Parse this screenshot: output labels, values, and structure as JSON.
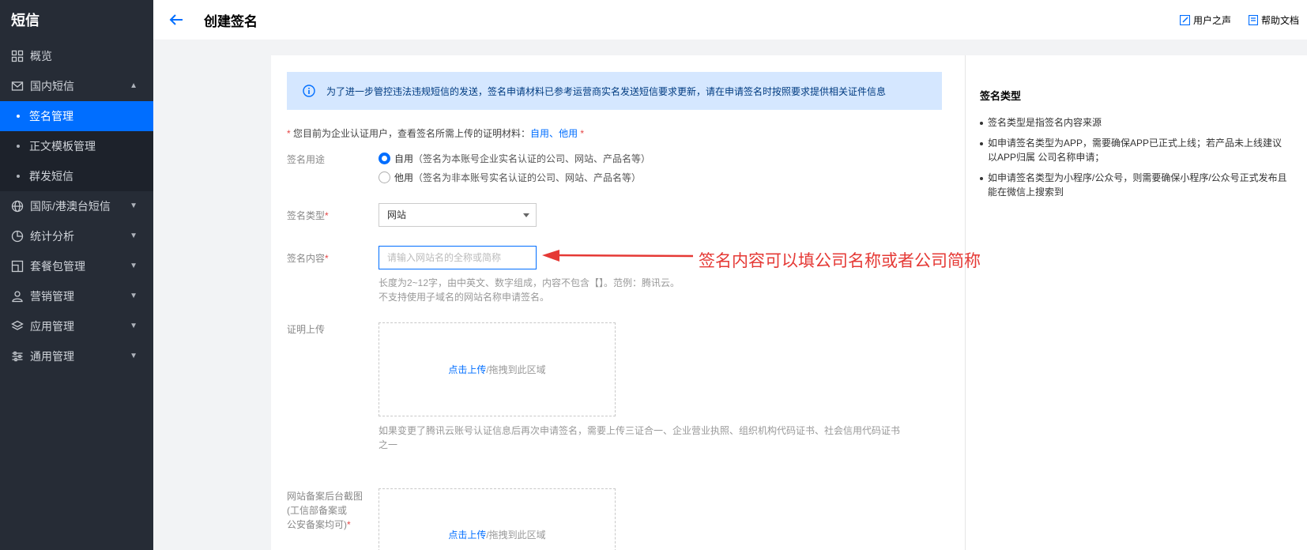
{
  "sidebar": {
    "brand": "短信",
    "items": [
      {
        "label": "概览",
        "icon": "grid-icon"
      },
      {
        "label": "国内短信",
        "icon": "mail-icon",
        "expanded": true,
        "children": [
          {
            "label": "签名管理",
            "active": true
          },
          {
            "label": "正文模板管理"
          },
          {
            "label": "群发短信"
          }
        ]
      },
      {
        "label": "国际/港澳台短信",
        "icon": "globe-icon"
      },
      {
        "label": "统计分析",
        "icon": "pie-chart-icon"
      },
      {
        "label": "套餐包管理",
        "icon": "package-icon"
      },
      {
        "label": "营销管理",
        "icon": "user-group-icon"
      },
      {
        "label": "应用管理",
        "icon": "layers-icon"
      },
      {
        "label": "通用管理",
        "icon": "sliders-icon"
      }
    ]
  },
  "header": {
    "title": "创建签名",
    "links": [
      "用户之声",
      "帮助文档"
    ]
  },
  "notice": "为了进一步管控违法违规短信的发送，签名申请材料已参考运营商实名发送短信要求更新，请在申请签名时按照要求提供相关证件信息",
  "req_note": {
    "prefix": "您目前为企业认证用户，查看签名所需上传的证明材料：",
    "link1": "自用",
    "sep": "、",
    "link2": "他用"
  },
  "form": {
    "usage": {
      "label": "签名用途",
      "options": [
        {
          "label": "自用",
          "hint": "（签名为本账号企业实名认证的公司、网站、产品名等）",
          "checked": true
        },
        {
          "label": "他用",
          "hint": "（签名为非本账号实名认证的公司、网站、产品名等）",
          "checked": false
        }
      ]
    },
    "type": {
      "label": "签名类型",
      "value": "网站"
    },
    "content": {
      "label": "签名内容",
      "placeholder": "请输入网站名的全称或简称",
      "help1": "长度为2~12字，由中英文、数字组成，内容不包含【】。范例：腾讯云。",
      "help2": "不支持使用子域名的网站名称申请签名。"
    },
    "proof": {
      "label": "证明上传",
      "upload_label": "点击上传",
      "drag_label": "/拖拽到此区域",
      "help1": "如果变更了腾讯云账号认证信息后再次申请签名，需要上传三证合一、企业营业执照、组织机构代码证书、社会信用代码证书",
      "help2": "之一"
    },
    "record": {
      "label1": "网站备案后台截图",
      "label2": "(工信部备案或",
      "label3": "公安备案均可)",
      "upload_label": "点击上传",
      "drag_label": "/拖拽到此区域"
    }
  },
  "annotation": "签名内容可以填公司名称或者公司简称",
  "side_panel": {
    "title": "签名类型",
    "items": [
      "签名类型是指签名内容来源",
      "如申请签名类型为APP，需要确保APP已正式上线；若产品未上线建议以APP归属 公司名称申请；",
      "如申请签名类型为小程序/公众号，则需要确保小程序/公众号正式发布且能在微信上搜索到"
    ]
  },
  "colors": {
    "sidebar_bg": "#262c36",
    "accent": "#006eff",
    "notice_bg": "#d5e7ff",
    "annotation": "#e53935",
    "required": "#e54545"
  }
}
